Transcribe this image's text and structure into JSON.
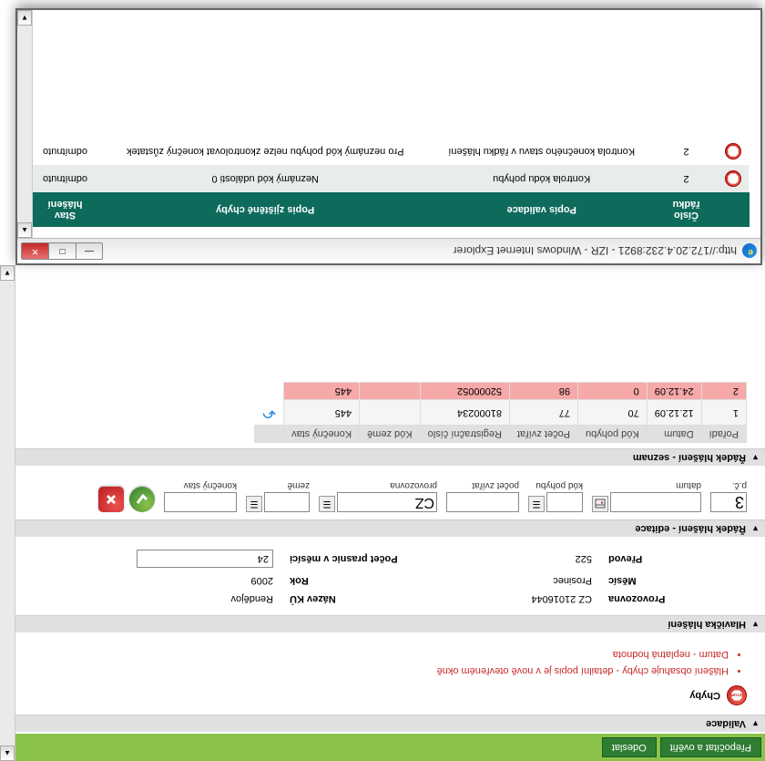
{
  "toolbar": {
    "recalc": "Přepočítat a ověřit",
    "send": "Odeslat"
  },
  "sections": {
    "validace": "Validace",
    "hlavicka": "Hlavička hlášení",
    "editace": "Řádek hlášení - editace",
    "seznam": "Řádek hlášení - seznam"
  },
  "errors": {
    "title": "Chyby",
    "items": [
      "Hlášení obsahuje chyby - detailní popis je v nově otevřeném okně",
      "Datum - neplatná hodnota"
    ]
  },
  "header": {
    "provozovna_l": "Provozovna",
    "provozovna_v": "CZ 21016044",
    "nazev_l": "Název KÚ",
    "nazev_v": "Rendějov",
    "mesic_l": "Měsíc",
    "mesic_v": "Prosinec",
    "rok_l": "Rok",
    "rok_v": "2009",
    "prevod_l": "Převod",
    "prevod_v": "522",
    "prasnic_l": "Počet prasnic v měsíci",
    "prasnic_v": "24"
  },
  "edit": {
    "pc": {
      "label": "p.č.",
      "value": "3"
    },
    "datum": {
      "label": "datum",
      "value": ""
    },
    "kod": {
      "label": "kód pohybu",
      "value": ""
    },
    "pocet": {
      "label": "počet zvířat",
      "value": ""
    },
    "provoz": {
      "label": "provozovna",
      "value": "CZ"
    },
    "zeme": {
      "label": "země",
      "value": ""
    },
    "konecny": {
      "label": "konečný stav",
      "value": ""
    }
  },
  "list": {
    "cols": [
      "Pořadí",
      "Datum",
      "Kód pohybu",
      "Počet zvířat",
      "Registrační číslo",
      "Kód země",
      "Konečný stav",
      ""
    ],
    "rows": [
      {
        "c": [
          "1",
          "12.12.09",
          "70",
          "77",
          "81000234",
          "",
          "445"
        ],
        "cls": "r1"
      },
      {
        "c": [
          "2",
          "24.12.09",
          "0",
          "98",
          "52000052",
          "",
          "445"
        ],
        "cls": "r2"
      }
    ]
  },
  "popup": {
    "title": "http://172.20.4.232:8921 - IZR - Windows Internet Explorer",
    "cols": {
      "cislo": "Číslo řádku",
      "popis_v": "Popis validace",
      "popis_ch": "Popis zjištěné chyby",
      "stav": "Stav hlášení"
    },
    "rows": [
      {
        "n": "2",
        "v": "Kontrola kódu pohybu",
        "e": "Neznámý kód události 0",
        "s": "odmítnuto"
      },
      {
        "n": "2",
        "v": "Kontrola konečného stavu v řádku hlášení",
        "e": "Pro neznámý kód pohybu nelze zkontrolovat konečný zůstatek",
        "s": "odmítnuto"
      }
    ]
  }
}
